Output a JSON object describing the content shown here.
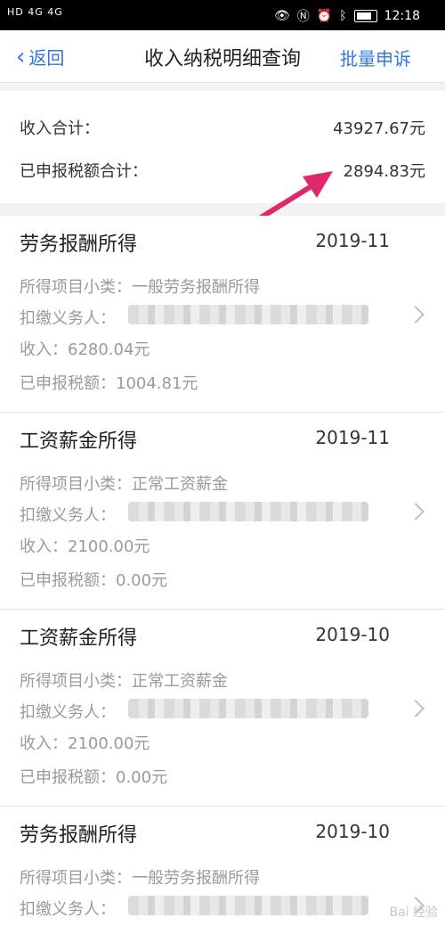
{
  "status_bar": {
    "left": "HD 4G 4G",
    "time": "12:18"
  },
  "nav": {
    "back": "返回",
    "title": "收入纳税明细查询",
    "action": "批量申诉"
  },
  "summary": {
    "income_label": "收入合计：",
    "income_value": "43927.67元",
    "tax_label": "已申报税额合计：",
    "tax_value": "2894.83元"
  },
  "items": [
    {
      "name": "劳务报酬所得",
      "date": "2019-11",
      "sub": "所得项目小类：一般劳务报酬所得",
      "payer": "扣缴义务人：",
      "income": "收入：6280.04元",
      "tax": "已申报税额：1004.81元"
    },
    {
      "name": "工资薪金所得",
      "date": "2019-11",
      "sub": "所得项目小类：正常工资薪金",
      "payer": "扣缴义务人：",
      "income": "收入：2100.00元",
      "tax": "已申报税额：0.00元"
    },
    {
      "name": "工资薪金所得",
      "date": "2019-10",
      "sub": "所得项目小类：正常工资薪金",
      "payer": "扣缴义务人：",
      "income": "收入：2100.00元",
      "tax": "已申报税额：0.00元"
    },
    {
      "name": "劳务报酬所得",
      "date": "2019-10",
      "sub": "所得项目小类：一般劳务报酬所得",
      "payer": "扣缴义务人："
    }
  ],
  "watermark": "Bai 经验",
  "colors": {
    "accent": "#2f78d8",
    "arrow": "#e0286e"
  }
}
